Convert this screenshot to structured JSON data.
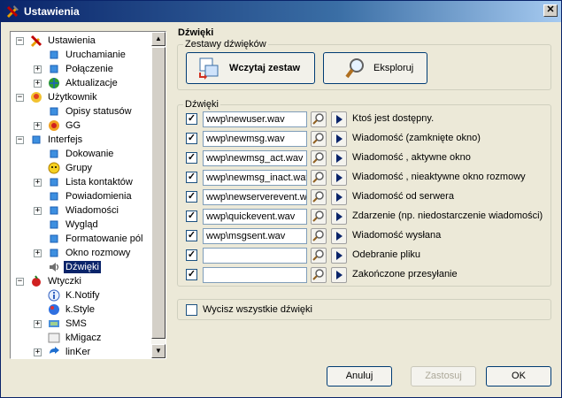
{
  "window": {
    "title": "Ustawienia",
    "close_glyph": "✕"
  },
  "tree": {
    "items": [
      {
        "label": "Ustawienia",
        "level": 0,
        "expander": "−",
        "icon": "tools-icon"
      },
      {
        "label": "Uruchamianie",
        "level": 1,
        "expander": "",
        "icon": "blue-square-icon"
      },
      {
        "label": "Połączenie",
        "level": 1,
        "expander": "+",
        "icon": "blue-square-icon"
      },
      {
        "label": "Aktualizacje",
        "level": 1,
        "expander": "+",
        "icon": "globe-icon"
      },
      {
        "label": "Użytkownik",
        "level": 0,
        "expander": "−",
        "icon": "user-icon"
      },
      {
        "label": "Opisy statusów",
        "level": 1,
        "expander": "",
        "icon": "blue-square-icon"
      },
      {
        "label": "GG",
        "level": 1,
        "expander": "+",
        "icon": "flower-icon"
      },
      {
        "label": "Interfejs",
        "level": 0,
        "expander": "−",
        "icon": "blue-square-icon"
      },
      {
        "label": "Dokowanie",
        "level": 1,
        "expander": "",
        "icon": "blue-square-icon"
      },
      {
        "label": "Grupy",
        "level": 1,
        "expander": "",
        "icon": "smiley-icon"
      },
      {
        "label": "Lista kontaktów",
        "level": 1,
        "expander": "+",
        "icon": "blue-square-icon"
      },
      {
        "label": "Powiadomienia",
        "level": 1,
        "expander": "",
        "icon": "blue-square-icon"
      },
      {
        "label": "Wiadomości",
        "level": 1,
        "expander": "+",
        "icon": "blue-square-icon"
      },
      {
        "label": "Wygląd",
        "level": 1,
        "expander": "",
        "icon": "blue-square-icon"
      },
      {
        "label": "Formatowanie pól",
        "level": 1,
        "expander": "",
        "icon": "blue-square-icon"
      },
      {
        "label": "Okno rozmowy",
        "level": 1,
        "expander": "+",
        "icon": "blue-square-icon"
      },
      {
        "label": "Dźwięki",
        "level": 1,
        "expander": "",
        "icon": "speaker-icon",
        "selected": true
      },
      {
        "label": "Wtyczki",
        "level": 0,
        "expander": "−",
        "icon": "plugin-icon"
      },
      {
        "label": "K.Notify",
        "level": 1,
        "expander": "",
        "icon": "info-icon"
      },
      {
        "label": "k.Style",
        "level": 1,
        "expander": "",
        "icon": "palette-icon"
      },
      {
        "label": "SMS",
        "level": 1,
        "expander": "+",
        "icon": "sms-icon"
      },
      {
        "label": "kMigacz",
        "level": 1,
        "expander": "",
        "icon": "blink-icon"
      },
      {
        "label": "linKer",
        "level": 1,
        "expander": "+",
        "icon": "link-icon"
      }
    ]
  },
  "panel": {
    "title": "Dźwięki",
    "sets_group": {
      "legend": "Zestawy dźwięków",
      "load_button": "Wczytaj zestaw",
      "explore_button": "Eksploruj"
    },
    "sounds_group": {
      "legend": "Dźwięki",
      "rows": [
        {
          "checked": true,
          "file": "wwp\\newuser.wav",
          "label": "Ktoś jest dostępny."
        },
        {
          "checked": true,
          "file": "wwp\\newmsg.wav",
          "label": "Wiadomość (zamknięte okno)"
        },
        {
          "checked": true,
          "file": "wwp\\newmsg_act.wav",
          "label": "Wiadomość , aktywne okno"
        },
        {
          "checked": true,
          "file": "wwp\\newmsg_inact.wav",
          "label": "Wiadomość , nieaktywne okno rozmowy"
        },
        {
          "checked": true,
          "file": "wwp\\newserverevent.wav",
          "label": "Wiadomość od serwera"
        },
        {
          "checked": true,
          "file": "wwp\\quickevent.wav",
          "label": "Zdarzenie (np. niedostarczenie wiadomości)"
        },
        {
          "checked": true,
          "file": "wwp\\msgsent.wav",
          "label": "Wiadomość wysłana"
        },
        {
          "checked": true,
          "file": "",
          "label": "Odebranie pliku"
        },
        {
          "checked": true,
          "file": "",
          "label": "Zakończone przesyłanie"
        }
      ]
    },
    "mute_all": {
      "label": "Wycisz wszystkie dźwięki",
      "checked": false
    }
  },
  "footer": {
    "cancel": "Anuluj",
    "apply": "Zastosuj",
    "ok": "OK"
  }
}
